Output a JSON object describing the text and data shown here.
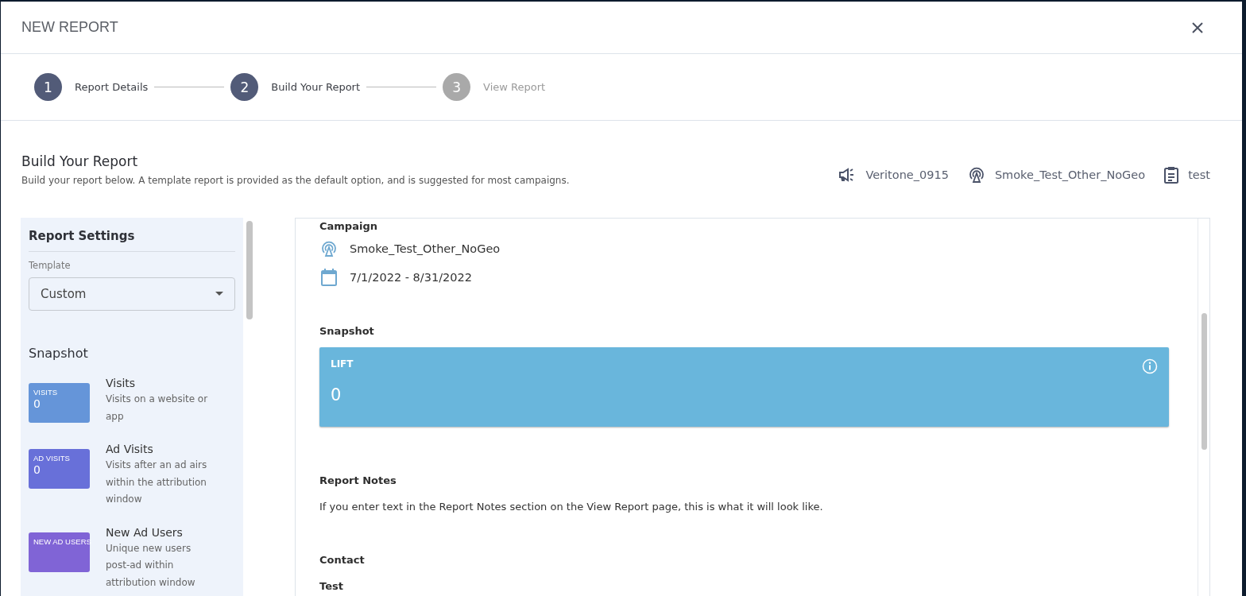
{
  "dialog": {
    "title": "NEW REPORT"
  },
  "steps": [
    {
      "number": "1",
      "label": "Report Details",
      "reached": true
    },
    {
      "number": "2",
      "label": "Build Your Report",
      "reached": true
    },
    {
      "number": "3",
      "label": "View Report",
      "reached": false
    }
  ],
  "page": {
    "title": "Build Your Report",
    "subtitle": "Build your report below. A template report is provided as the default option, and is suggested for most campaigns."
  },
  "meta": [
    {
      "kind": "advertiser",
      "text": "Veritone_0915"
    },
    {
      "kind": "campaign",
      "text": "Smoke_Test_Other_NoGeo"
    },
    {
      "kind": "report",
      "text": "test"
    }
  ],
  "sidebar": {
    "title": "Report Settings",
    "template_label": "Template",
    "template_value": "Custom",
    "section": "Snapshot",
    "metrics": [
      {
        "tile_label": "VISITS",
        "tile_value": "0",
        "color": "#6595d9",
        "name": "Visits",
        "description": "Visits on a website or app"
      },
      {
        "tile_label": "AD VISITS",
        "tile_value": "0",
        "color": "#6870d9",
        "name": "Ad Visits",
        "description": "Visits after an ad airs within the attribution window"
      },
      {
        "tile_label": "NEW AD USERS",
        "color": "#8064d6",
        "name": "New Ad Users",
        "description": "Unique new users post-ad within attribution window"
      }
    ]
  },
  "preview": {
    "campaign_heading": "Campaign",
    "details": [
      {
        "kind": "campaign",
        "text": "Smoke_Test_Other_NoGeo"
      },
      {
        "kind": "dates",
        "text": "7/1/2022 - 8/31/2022"
      }
    ],
    "snapshot_heading": "Snapshot",
    "snapshot_card": {
      "label": "LIFT",
      "value": "0"
    },
    "notes_heading": "Report Notes",
    "notes_text": "If you enter text in the Report Notes section on the View Report page, this is what it will look like.",
    "contact_heading": "Contact",
    "contact_name": "Test"
  }
}
